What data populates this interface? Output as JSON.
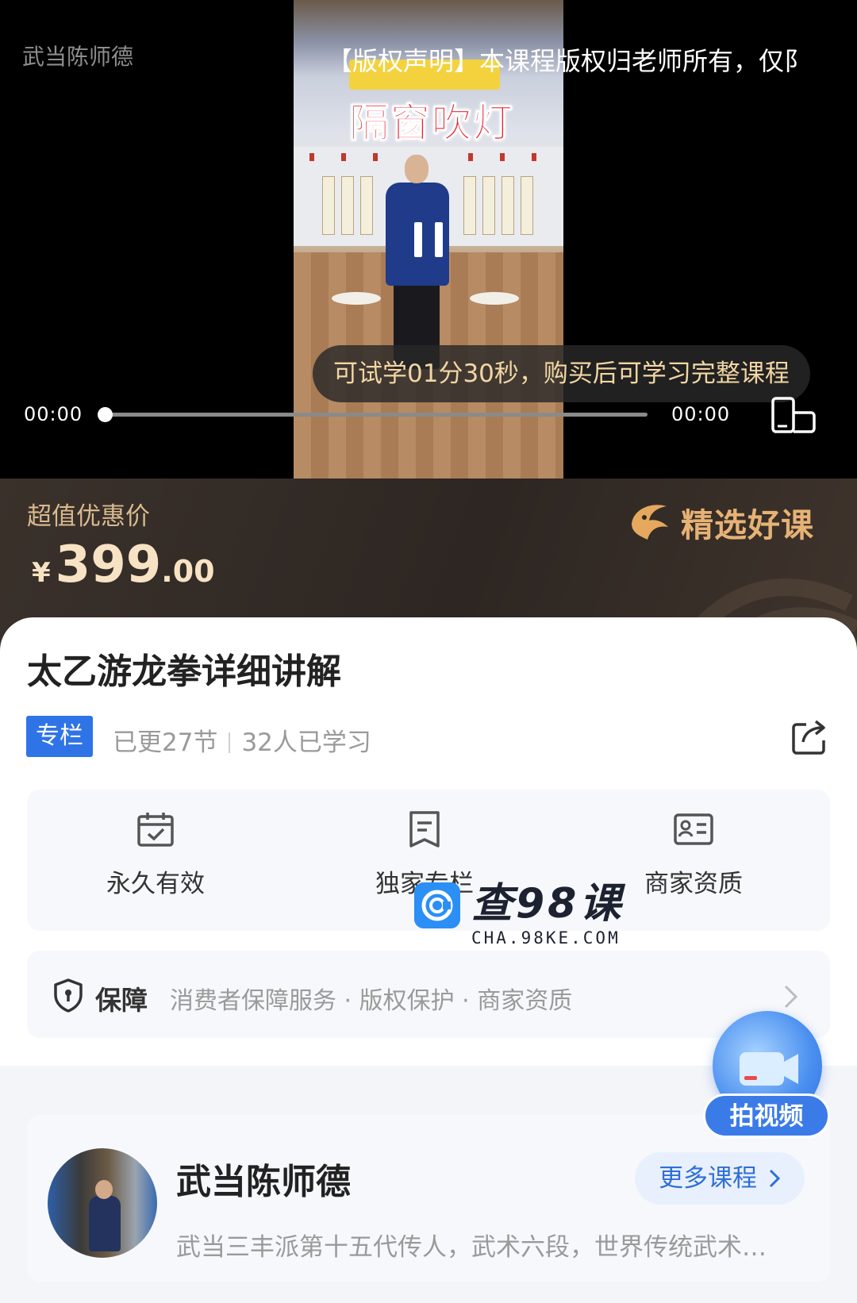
{
  "player": {
    "watermark": "武当陈师德",
    "copyright_notice": "【版权声明】本课程版权归老师所有，仅阝",
    "style_title": "隔窗吹灯",
    "trial_text": "可试学01分30秒，购买后可学习完整课程",
    "time_current": "00:00",
    "time_total": "00:00",
    "progress": 0
  },
  "price": {
    "label": "超值优惠价",
    "currency": "¥",
    "integer": "399",
    "decimal": ".00",
    "badge": "精选好课"
  },
  "course": {
    "title": "太乙游龙拳详细讲解",
    "tag": "专栏",
    "updated": "已更27节",
    "learners": "32人已学习"
  },
  "features": [
    {
      "label": "永久有效",
      "icon": "calendar-check-icon"
    },
    {
      "label": "独家专栏",
      "icon": "document-icon"
    },
    {
      "label": "商家资质",
      "icon": "id-card-icon"
    }
  ],
  "guarantee": {
    "title": "保障",
    "text": "消费者保障服务 · 版权保护 · 商家资质"
  },
  "site_watermark": {
    "name": "查98课",
    "url": "CHA.98KE.COM"
  },
  "fab": {
    "label": "拍视频"
  },
  "author": {
    "name": "武当陈师德",
    "more_label": "更多课程",
    "description": "武当三丰派第十五代传人，武术六段，世界传统武术…"
  },
  "colors": {
    "accent": "#2f74e6",
    "price": "#f7e3c4",
    "badge": "#e6b275"
  }
}
